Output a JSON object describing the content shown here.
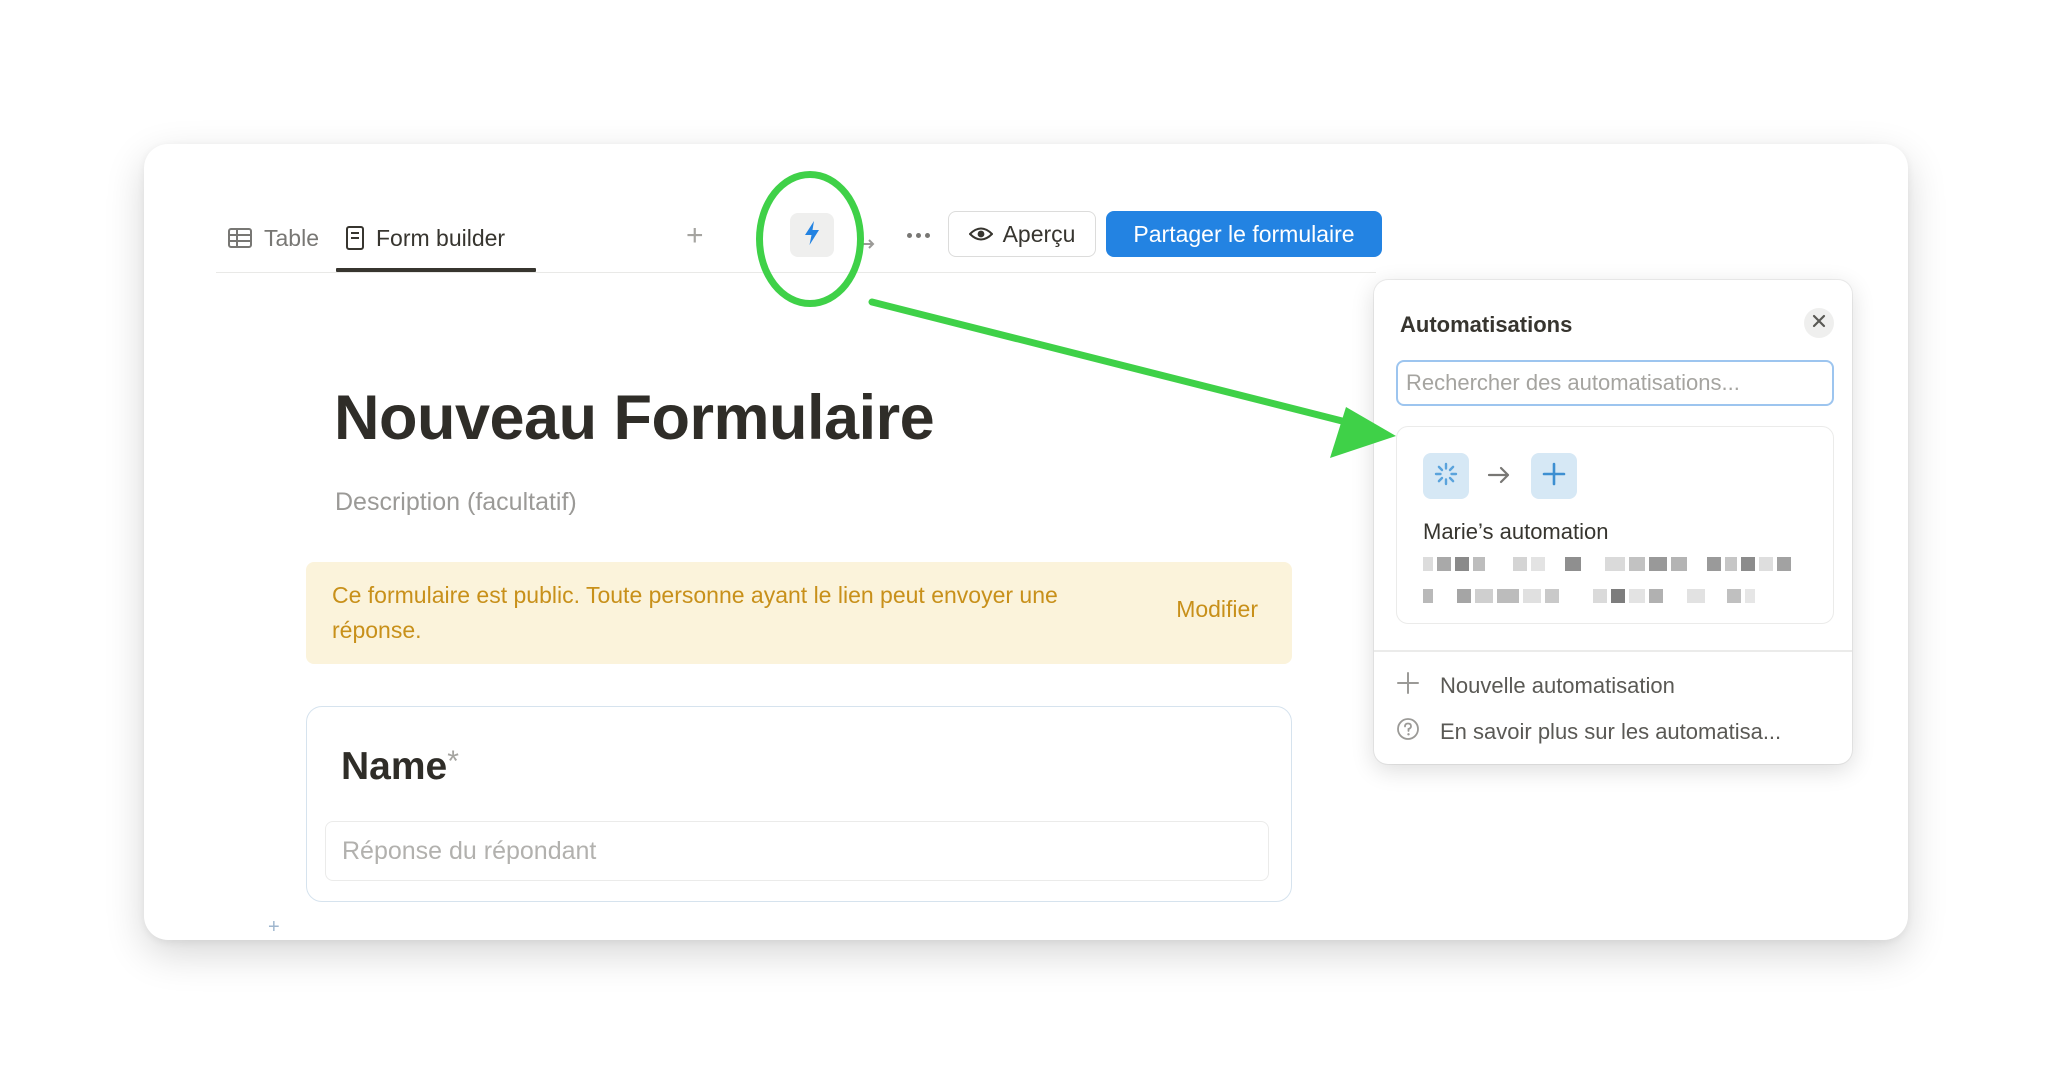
{
  "tabs": [
    {
      "label": "Table",
      "icon": "table-icon"
    },
    {
      "label": "Form builder",
      "icon": "document-icon",
      "active": true
    }
  ],
  "toolbar": {
    "add_tab_icon": "plus-icon",
    "automation_icon": "lightning-icon",
    "sync_icon": "sync-icon",
    "more_icon": "more-horizontal-icon",
    "preview_label": "Aperçu",
    "preview_icon": "eye-icon",
    "share_label": "Partager le formulaire"
  },
  "form": {
    "title": "Nouveau Formulaire",
    "description_placeholder": "Description (facultatif)",
    "notice": {
      "text": "Ce formulaire est public. Toute personne ayant le lien peut envoyer une réponse.",
      "link": "Modifier"
    },
    "fields": [
      {
        "label": "Name",
        "required_mark": "*",
        "placeholder": "Réponse du répondant"
      }
    ],
    "add_block_icon": "plus-icon"
  },
  "automations_panel": {
    "title": "Automatisations",
    "search_placeholder": "Rechercher des automatisations...",
    "items": [
      {
        "name": "Marie’s automation",
        "trigger_icon": "loading-spinner-icon",
        "action_icon": "plus-icon"
      }
    ],
    "footer_actions": [
      {
        "label": "Nouvelle automatisation",
        "icon": "plus-icon"
      },
      {
        "label": "En savoir plus sur les automatisa...",
        "icon": "help-circle-icon"
      }
    ]
  },
  "colors": {
    "accent": "#2383e2",
    "annotation": "#3fd148",
    "notice_bg": "#fbf3db",
    "notice_text": "#c8901a",
    "icon_bg": "#d6e8f5"
  }
}
